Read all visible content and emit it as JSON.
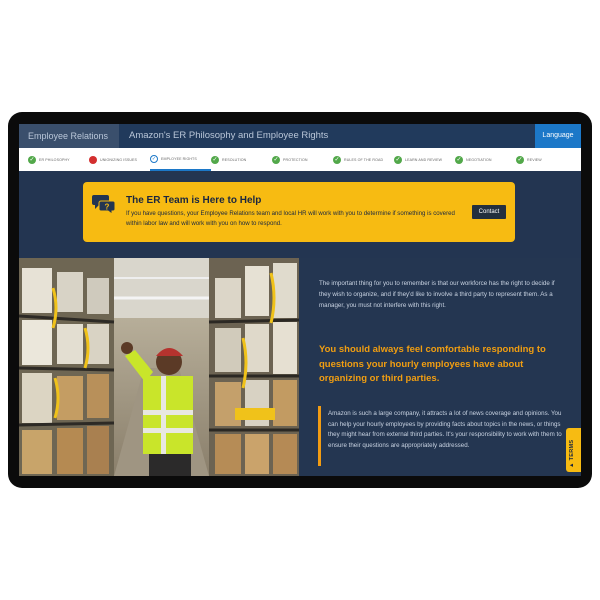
{
  "header": {
    "section": "Employee Relations",
    "title": "Amazon's ER Philosophy and Employee Rights",
    "language_button": "Language"
  },
  "progress": {
    "steps": [
      {
        "label": "ER PHILOSOPHY",
        "status": "complete"
      },
      {
        "label": "UNIONIZING ISSUES",
        "status": "error"
      },
      {
        "label": "EMPLOYEE RIGHTS",
        "status": "current"
      },
      {
        "label": "RESOLUTION",
        "status": "complete"
      },
      {
        "label": "PROTECTION",
        "status": "complete"
      },
      {
        "label": "RULES OF THE ROAD",
        "status": "complete"
      },
      {
        "label": "LEARN AND REVIEW",
        "status": "complete"
      },
      {
        "label": "NEGOTIATION",
        "status": "complete"
      },
      {
        "label": "REVIEW",
        "status": "complete"
      }
    ]
  },
  "callout": {
    "icon": "chat-question-icon",
    "title": "The ER Team is Here to Help",
    "body": "If you have questions, your Employee Relations team and local HR will work with you to determine if something is covered within labor law and will work with you on how to respond.",
    "contact_button": "Contact"
  },
  "photo": {
    "subject": "warehouse worker in hi-vis vest"
  },
  "content": {
    "paragraph1": "The important thing for you to remember is that our workforce has the right to decide if they wish to organize, and if they'd like to involve a third party to represent them. As a manager, you must not interfere with this right.",
    "quote": "You should always feel comfortable responding to questions your hourly employees have about organizing or third parties.",
    "paragraph2": "Amazon is such a large company, it attracts a lot of news coverage and opinions. You can help your hourly employees by providing facts about topics in the news, or things they might hear from external third parties. It's your responsibility to work with them to ensure their questions are appropriately addressed."
  },
  "terms_tab": "▲ TERMS",
  "colors": {
    "navy": "#233551",
    "accent_yellow": "#f7bb12",
    "accent_orange": "#f19e11",
    "link_blue": "#1c78c8",
    "complete_green": "#52a84a",
    "error_red": "#d32f2f"
  }
}
